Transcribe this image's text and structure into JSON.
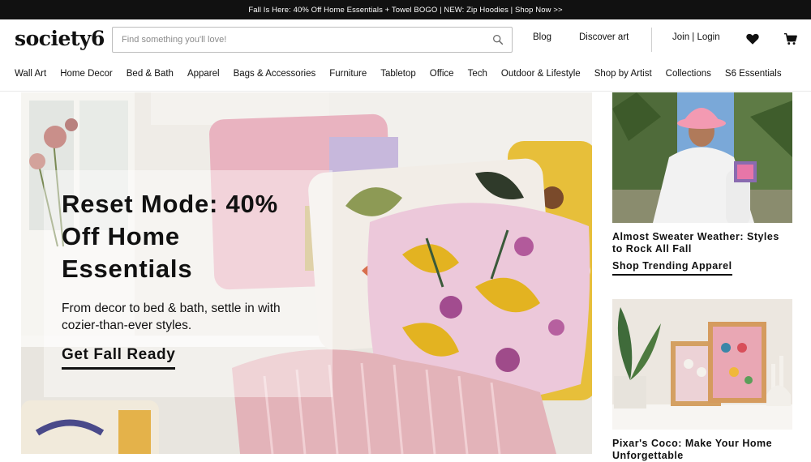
{
  "promo": {
    "text": "Fall Is Here: 40% Off Home Essentials + Towel BOGO | NEW: Zip Hoodies | Shop Now >>"
  },
  "header": {
    "logo": "society6",
    "search_placeholder": "Find something you'll love!",
    "links": {
      "blog": "Blog",
      "discover": "Discover art",
      "login": "Join | Login"
    },
    "icons": [
      "search-icon",
      "heart-icon",
      "cart-icon"
    ]
  },
  "categories": [
    "Wall Art",
    "Home Decor",
    "Bed & Bath",
    "Apparel",
    "Bags & Accessories",
    "Furniture",
    "Tabletop",
    "Office",
    "Tech",
    "Outdoor & Lifestyle",
    "Shop by Artist",
    "Collections",
    "S6 Essentials"
  ],
  "hero": {
    "title": "Reset Mode: 40% Off Home Essentials",
    "subtitle": "From decor to bed & bath, settle in with cozier-than-ever styles.",
    "cta": "Get Fall Ready"
  },
  "side_cards": [
    {
      "title": "Almost Sweater Weather: Styles to Rock All Fall",
      "cta": "Shop Trending Apparel"
    },
    {
      "title": "Pixar's Coco: Make Your Home Unforgettable",
      "cta": ""
    }
  ],
  "colors": {
    "promo_bg": "#111111",
    "text": "#111111",
    "pillow_pink": "#e9b3c0",
    "accent_yellow": "#e3b321"
  }
}
